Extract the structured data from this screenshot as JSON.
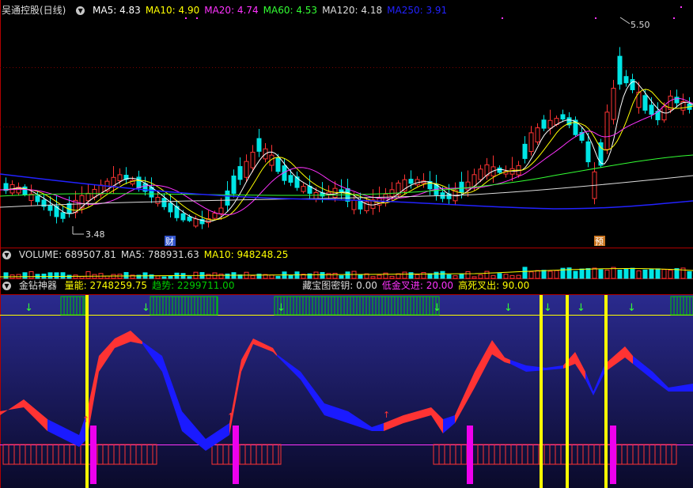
{
  "main": {
    "stock_name": "吴通控股(日线)",
    "ma_items": [
      {
        "label": "MA5: 4.83",
        "color": "#ffffff"
      },
      {
        "label": "MA10: 4.90",
        "color": "#ffff00"
      },
      {
        "label": "MA20: 4.74",
        "color": "#ff33ff"
      },
      {
        "label": "MA60: 4.53",
        "color": "#33ff33"
      },
      {
        "label": "MA120: 4.18",
        "color": "#dddddd"
      },
      {
        "label": "MA250: 3.91",
        "color": "#2222ff"
      }
    ],
    "high_label": "5.50",
    "low_label": "3.48",
    "marker_cai": "财",
    "marker_yu": "预"
  },
  "volume": {
    "items": [
      {
        "label": "VOLUME: 689507.81",
        "color": "#dddddd"
      },
      {
        "label": "MA5: 788931.63",
        "color": "#dddddd"
      },
      {
        "label": "MA10: 948248.25",
        "color": "#ffff00"
      }
    ]
  },
  "indicator": {
    "title": "金钻神器",
    "items": [
      {
        "label": "量能: 2748259.75",
        "color": "#ffff00"
      },
      {
        "label": "趋势: 2299711.00",
        "color": "#00cc00"
      }
    ],
    "items2": [
      {
        "label": "藏宝图密钥: 0.00",
        "color": "#dddddd"
      },
      {
        "label": "低金叉进: 20.00",
        "color": "#ff33ff"
      },
      {
        "label": "高死叉出: 90.00",
        "color": "#ffff00"
      }
    ]
  },
  "colors": {
    "up": "#ff3333",
    "down": "#00e5e5",
    "panel_border": "#b00000"
  }
}
